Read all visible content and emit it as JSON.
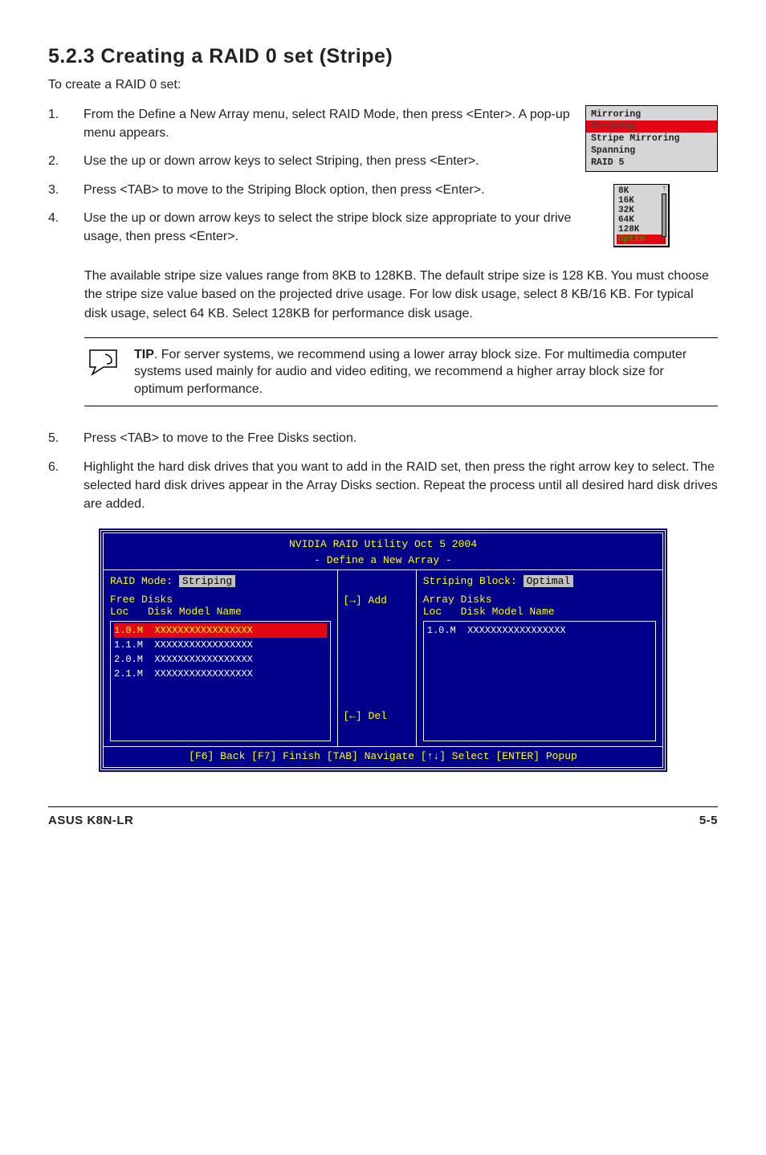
{
  "heading": "5.2.3   Creating a RAID 0 set (Stripe)",
  "intro": "To create a RAID 0 set:",
  "steps_a": [
    "From the Define a New Array menu, select RAID Mode, then press <Enter>. A pop-up menu appears.",
    "Use the up or down arrow keys to select Striping, then press <Enter>.",
    "Press <TAB> to move to the Striping Block option, then press <Enter>.",
    "Use the up or down arrow keys to select the stripe block size appropriate to your drive usage, then press <Enter>."
  ],
  "num": {
    "1": "1.",
    "2": "2.",
    "3": "3.",
    "4": "4.",
    "5": "5.",
    "6": "6."
  },
  "after": "The available stripe size values range from 8KB to 128KB. The default stripe size is 128 KB. You must choose the stripe size value based on the projected drive usage. For low disk usage, select 8 KB/16 KB. For typical disk usage, select 64 KB. Select 128KB for performance disk usage.",
  "tip": {
    "label": "TIP",
    "text": ". For server systems, we recommend using a lower array block size. For multimedia computer systems used mainly for audio and video editing, we recommend a higher array block size for optimum performance."
  },
  "steps_b": [
    "Press <TAB> to move to the Free Disks section.",
    "Highlight the hard disk drives that you want to add in the RAID set, then press the right arrow key to select. The selected hard disk drives appear in the Array Disks section. Repeat the process until all desired hard disk drives are added."
  ],
  "menu1": [
    "Mirroring",
    "Striping",
    "Stripe Mirroring",
    "Spanning",
    "RAID 5"
  ],
  "menu2": [
    "8K",
    "16K",
    "32K",
    "64K",
    "128K",
    "Optim"
  ],
  "bios": {
    "title1": "NVIDIA RAID Utility  Oct 5 2004",
    "title2": "- Define a New Array -",
    "raid_mode_lbl": "RAID Mode:",
    "raid_mode_val": "Striping",
    "strip_lbl": "Striping Block:",
    "strip_val": "Optimal",
    "free_lbl": "Free Disks",
    "array_lbl": "Array Disks",
    "loc_hdr": "Loc",
    "model_hdr": "Disk Model Name",
    "free": [
      [
        "1.0.M",
        "XXXXXXXXXXXXXXXXX"
      ],
      [
        "1.1.M",
        "XXXXXXXXXXXXXXXXX"
      ],
      [
        "2.0.M",
        "XXXXXXXXXXXXXXXXX"
      ],
      [
        "2.1.M",
        "XXXXXXXXXXXXXXXXX"
      ]
    ],
    "array": [
      [
        "1.0.M",
        "XXXXXXXXXXXXXXXXX"
      ]
    ],
    "add": "[→] Add",
    "del": "[←] Del",
    "foot": "[F6] Back  [F7] Finish  [TAB] Navigate  [↑↓] Select  [ENTER] Popup"
  },
  "footer": {
    "left": "ASUS K8N-LR",
    "right": "5-5"
  }
}
